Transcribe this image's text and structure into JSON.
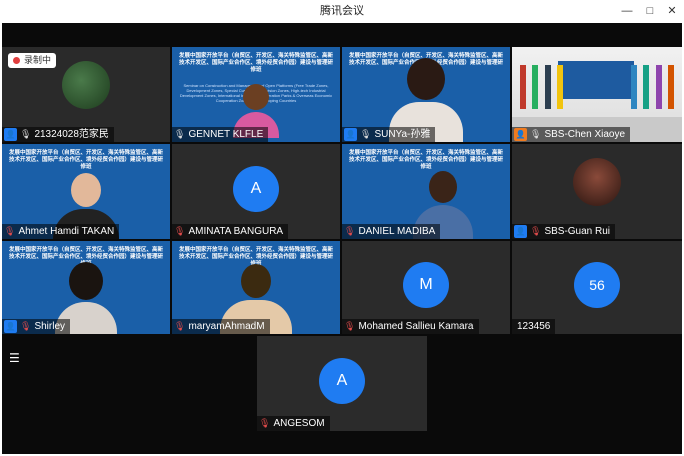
{
  "window": {
    "title": "腾讯会议",
    "controls": {
      "minimize": "—",
      "maximize": "□",
      "close": "✕"
    }
  },
  "recording": {
    "label": "录制中"
  },
  "slide": {
    "title_cn": "发展中国家开放平台（自贸区、开发区、海关特殊监管区、高新技术开发区、国际产业合作区、境外经贸合作园）建设与管理研修班",
    "title_en": "Seminar on Construction and Management of Open Platforms (Free Trade Zones, Development Zones, Special Customs Supervision Zones, High-tech Industrial Development Zones, International Industrial Cooperation Parks & Overseas Economic Cooperation Zones) for Developing Countries"
  },
  "participants": [
    {
      "id": "p1",
      "name": "21324028范家民",
      "host": true,
      "mic": "on",
      "type": "video-dark"
    },
    {
      "id": "p2",
      "name": "GENNET KLFLE",
      "host": false,
      "mic": "on",
      "type": "slide-person"
    },
    {
      "id": "p3",
      "name": "SUNYa-孙雅",
      "host": true,
      "mic": "on",
      "type": "slide-person"
    },
    {
      "id": "p4",
      "name": "SBS-Chen Xiaoye",
      "host": true,
      "host_color": "orange",
      "mic": "speaking",
      "type": "conference"
    },
    {
      "id": "p5",
      "name": "Ahmet Hamdi TAKAN",
      "host": false,
      "mic": "off",
      "type": "slide-person"
    },
    {
      "id": "p6",
      "name": "AMINATA BANGURA",
      "host": false,
      "mic": "off",
      "type": "avatar",
      "initial": "A"
    },
    {
      "id": "p7",
      "name": "DANIEL MADIBA",
      "host": false,
      "mic": "off",
      "type": "slide-person"
    },
    {
      "id": "p8",
      "name": "SBS-Guan Rui",
      "host": true,
      "mic": "off",
      "type": "video-dark"
    },
    {
      "id": "p9",
      "name": "Shirley",
      "host": true,
      "mic": "off",
      "type": "slide-person"
    },
    {
      "id": "p10",
      "name": "maryamAhmadM",
      "host": false,
      "mic": "off",
      "type": "slide-person"
    },
    {
      "id": "p11",
      "name": "Mohamed Sallieu Kamara",
      "host": false,
      "mic": "off",
      "type": "avatar",
      "initial": "M"
    },
    {
      "id": "p12",
      "name": "123456",
      "host": false,
      "mic": "none",
      "type": "avatar",
      "initial": "56"
    },
    {
      "id": "p13",
      "name": "ANGESOM",
      "host": false,
      "mic": "off",
      "type": "avatar",
      "initial": "A"
    }
  ],
  "icons": {
    "menu": "list-menu-icon",
    "mic": "microphone-icon",
    "host": "user-icon"
  },
  "colors": {
    "avatar": "#1f7cf2",
    "host_badge": "#1f7cf2",
    "host_badge_alt": "#f07b1f",
    "stage_bg": "#0a0a0a",
    "slide_bg": "#1a5fa8"
  }
}
